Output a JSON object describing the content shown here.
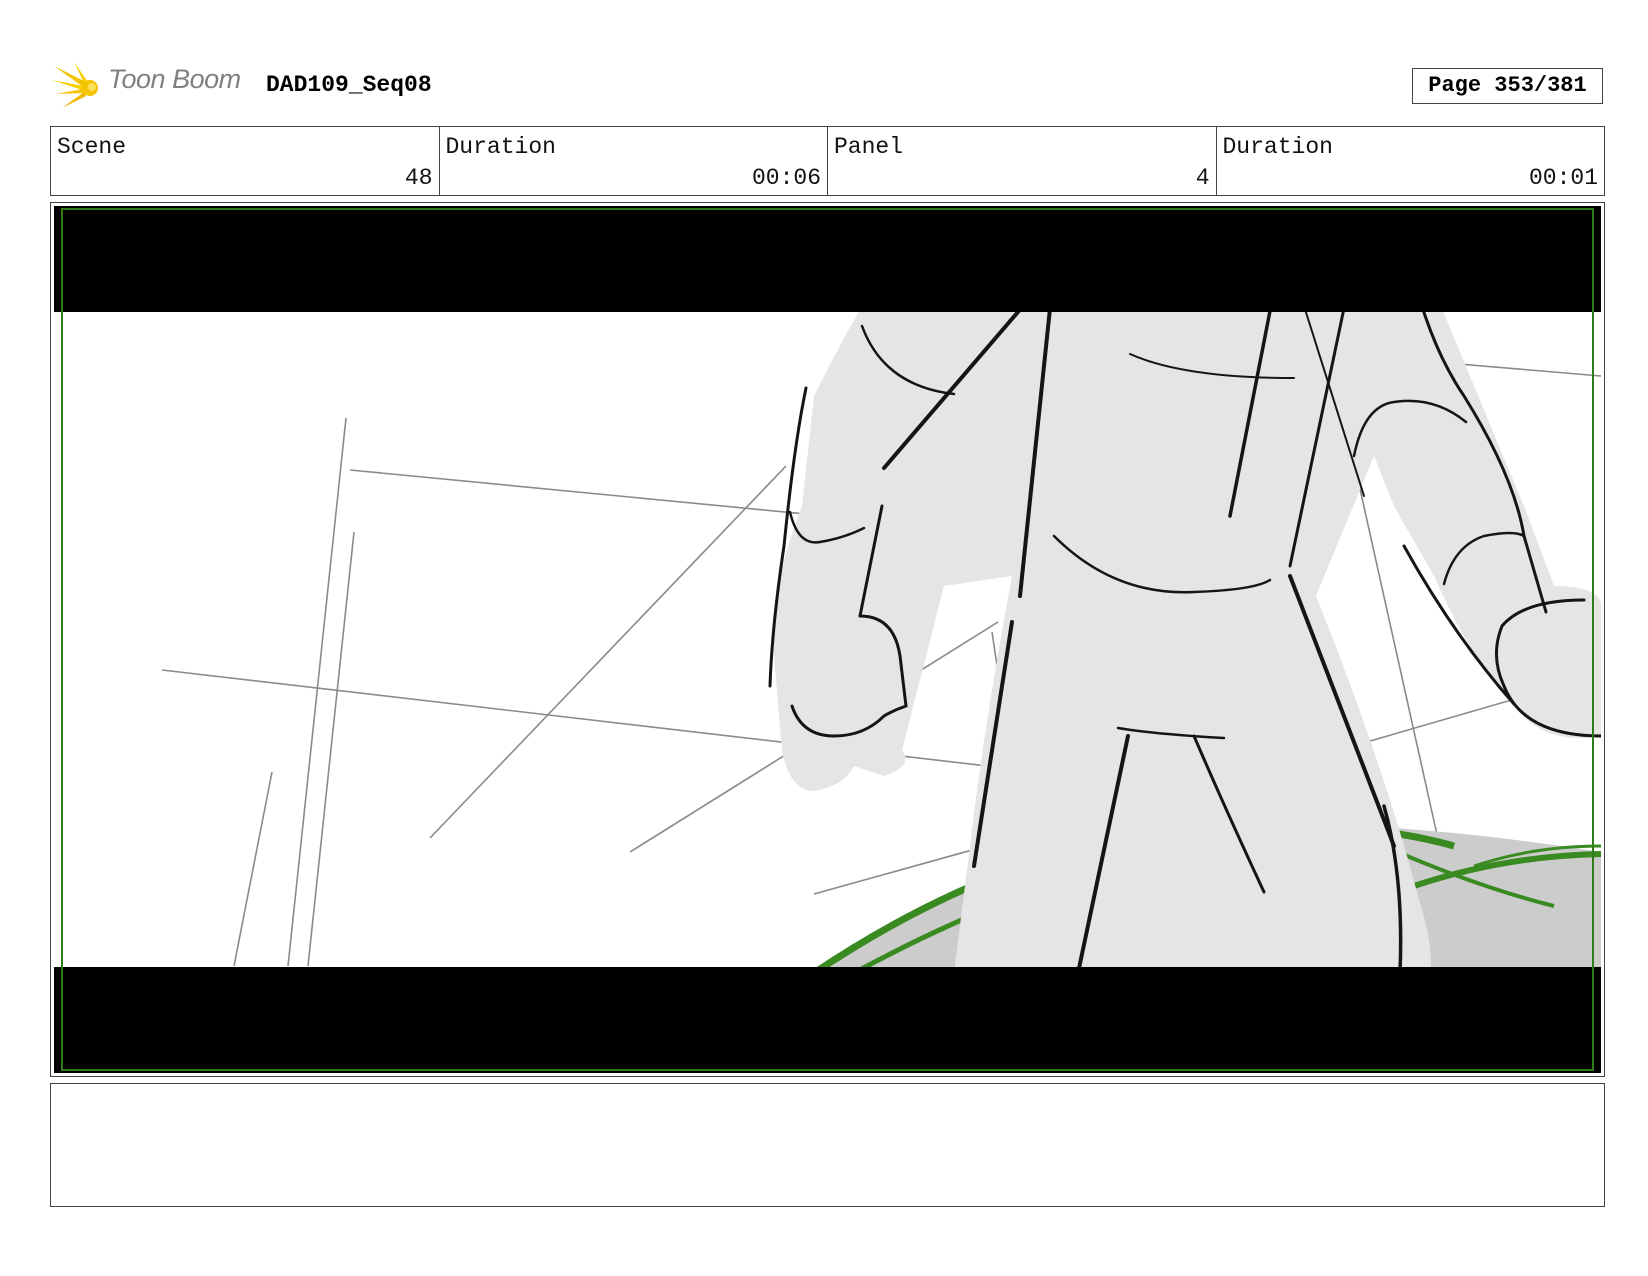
{
  "header": {
    "logo_text": "Toon Boom",
    "document_title": "DAD109_Seq08",
    "page_label": "Page 353/381"
  },
  "info": {
    "scene_label": "Scene",
    "scene_value": "48",
    "scene_duration_label": "Duration",
    "scene_duration_value": "00:06",
    "panel_label": "Panel",
    "panel_value": "4",
    "panel_duration_label": "Duration",
    "panel_duration_value": "00:01"
  },
  "colors": {
    "letterbox": "#000000",
    "safe_frame": "#2e7d1a",
    "character_fill": "#e5e5e5",
    "ground_fill": "#cccccc",
    "ground_outline": "#3a8a22",
    "logo_star": "#f5c400"
  },
  "icons": {
    "logo": "toon-boom-star-icon"
  },
  "notes": {
    "text": ""
  }
}
